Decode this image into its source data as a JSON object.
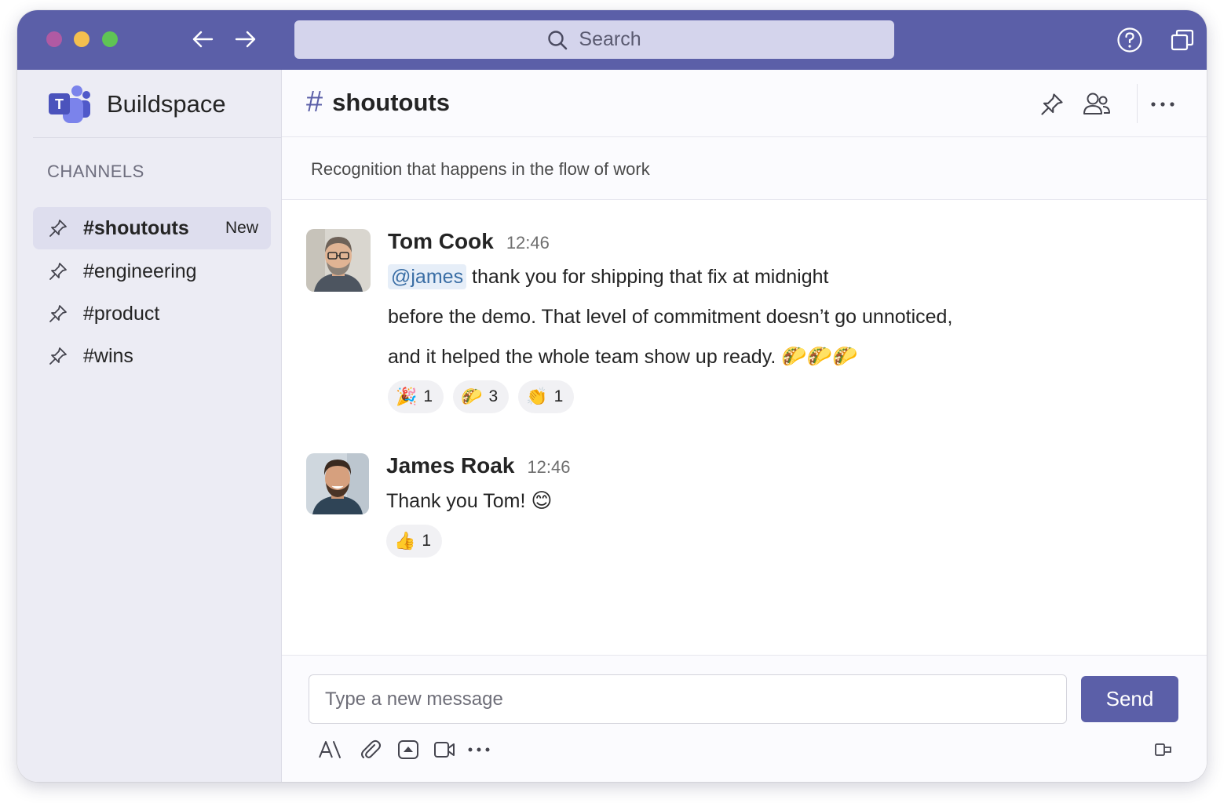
{
  "window": {
    "colors": {
      "titlebar": "#5b5fa8",
      "accent": "#5b5fa8",
      "sidebar_bg": "#ececf4"
    }
  },
  "titlebar": {
    "search_placeholder": "Search",
    "icons": [
      "arrow-left-icon",
      "arrow-right-icon",
      "search-icon",
      "help-icon",
      "popout-icon"
    ]
  },
  "sidebar": {
    "brand": "Buildspace",
    "channels_heading": "CHANNELS",
    "channels": [
      {
        "label": "#shoutouts",
        "badge": "New",
        "active": true
      },
      {
        "label": "#engineering"
      },
      {
        "label": "#product"
      },
      {
        "label": "#wins"
      }
    ]
  },
  "channel": {
    "name": "shoutouts",
    "hash": "#",
    "description": "Recognition that happens in the flow of work"
  },
  "messages": [
    {
      "author": "Tom Cook",
      "time": "12:46",
      "mention": "@james",
      "lines": [
        "thank you for shipping that fix at midnight",
        "before the demo. That level of commitment doesn’t go unnoticed,",
        "and it helped the whole team show up ready."
      ],
      "trailing_emoji": "🌮🌮🌮",
      "reactions": [
        {
          "emoji": "🎉",
          "count": "1"
        },
        {
          "emoji": "🌮",
          "count": "3"
        },
        {
          "emoji": "👏",
          "count": "1"
        }
      ]
    },
    {
      "author": "James Roak",
      "time": "12:46",
      "text": "Thank you Tom!",
      "trailing_emoji": "😊",
      "reactions": [
        {
          "emoji": "👍",
          "count": "1"
        }
      ]
    }
  ],
  "composer": {
    "placeholder": "Type a new message",
    "send_label": "Send",
    "tools": [
      "format-icon",
      "attach-icon",
      "sticker-icon",
      "video-clip-icon",
      "more-icon",
      "extension-icon"
    ]
  }
}
